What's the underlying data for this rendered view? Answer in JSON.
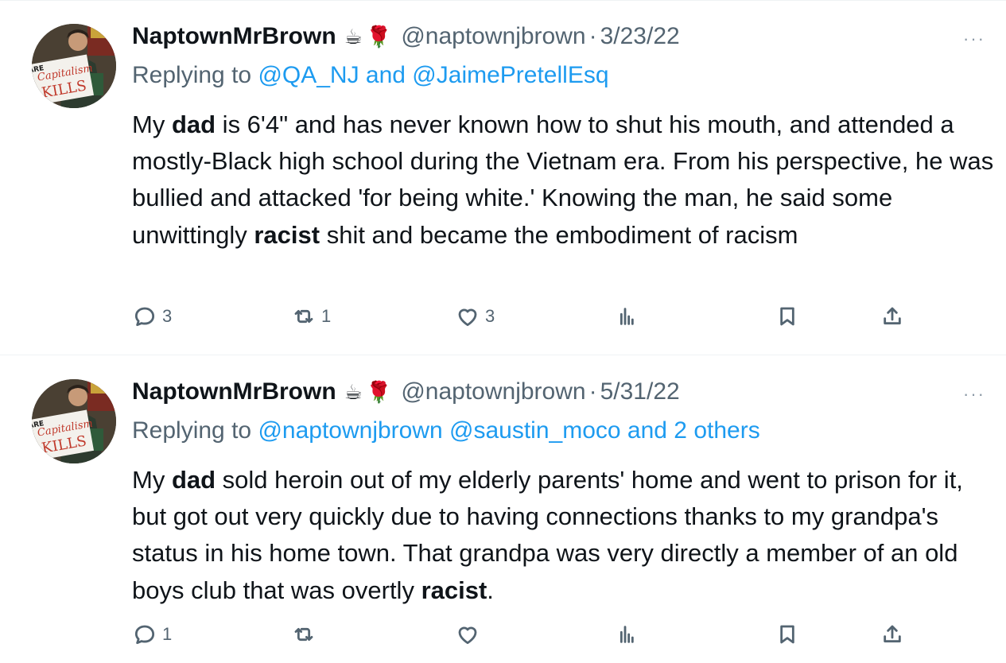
{
  "tweets": [
    {
      "author_name": "NaptownMrBrown",
      "emoji1": "☕",
      "emoji2": "🌹",
      "handle": "@naptownjbrown",
      "dot": "·",
      "date": "3/23/22",
      "more": "···",
      "reply_prefix": "Replying to ",
      "reply_targets": "@QA_NJ and @JaimePretellEsq",
      "body": [
        {
          "t": "My ",
          "bold": false
        },
        {
          "t": "dad",
          "bold": true
        },
        {
          "t": " is 6'4\" and has never known how to shut his mouth, and attended a mostly-Black high school during the Vietnam era. From his perspective, he was bullied and attacked 'for being white.' Knowing the man, he said some unwittingly ",
          "bold": false
        },
        {
          "t": "racist",
          "bold": true
        },
        {
          "t": " shit and became the embodiment of racism",
          "bold": false
        }
      ],
      "reply_count": "3",
      "retweet_count": "1",
      "like_count": "3",
      "avatar_sign_lines": [
        "Capitalism",
        "KILLS"
      ],
      "avatar_sign_edge": "ARE"
    },
    {
      "author_name": "NaptownMrBrown",
      "emoji1": "☕",
      "emoji2": "🌹",
      "handle": "@naptownjbrown",
      "dot": "·",
      "date": "5/31/22",
      "more": "···",
      "reply_prefix": "Replying to ",
      "reply_targets": "@naptownjbrown @saustin_moco and 2 others",
      "body": [
        {
          "t": "My ",
          "bold": false
        },
        {
          "t": "dad",
          "bold": true
        },
        {
          "t": " sold heroin out of my elderly parents' home and went to prison for it, but got out very quickly due to having connections thanks to my grandpa's status in his home town. That  grandpa was very directly a member of an old boys club that was overtly ",
          "bold": false
        },
        {
          "t": "racist",
          "bold": true
        },
        {
          "t": ".",
          "bold": false
        }
      ],
      "reply_count": "1",
      "retweet_count": "",
      "like_count": "",
      "avatar_sign_lines": [
        "Capitalism",
        "KILLS"
      ],
      "avatar_sign_edge": "ARE"
    }
  ],
  "icons": {
    "reply": "reply-icon",
    "retweet": "retweet-icon",
    "like": "heart-icon",
    "views": "views-icon",
    "bookmark": "bookmark-icon",
    "share": "share-icon",
    "more": "more-icon"
  },
  "colors": {
    "link": "#1d9bf0",
    "secondary_text": "#536471",
    "primary_text": "#0f1419",
    "divider": "#eff3f4"
  }
}
